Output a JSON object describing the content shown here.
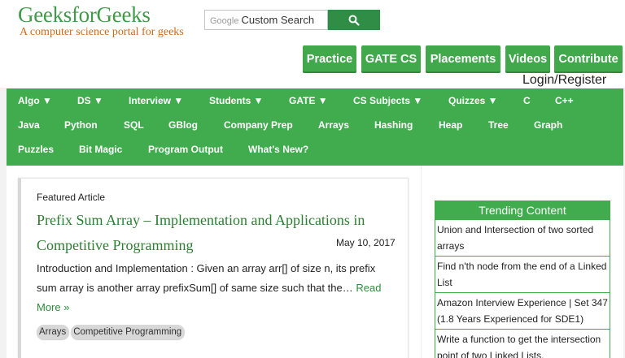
{
  "header": {
    "logo_title": "GeeksforGeeks",
    "logo_subtitle": "A computer science portal for geeks",
    "search_placeholder_brand": "Google",
    "search_placeholder": "Custom Search",
    "search_icon": "magnifier-icon",
    "top_nav": [
      "Practice",
      "GATE CS",
      "Placements",
      "Videos",
      "Contribute"
    ],
    "login_text": "Login/Register"
  },
  "menu": {
    "row1": [
      "Algo ▼",
      "DS ▼",
      "Interview ▼",
      "Students ▼",
      "GATE ▼",
      "CS Subjects ▼",
      "Quizzes ▼",
      "C",
      "C++"
    ],
    "row2": [
      "Java",
      "Python",
      "SQL",
      "GBlog",
      "Company Prep",
      "Arrays",
      "Hashing",
      "Heap",
      "Tree",
      "Graph"
    ],
    "row3": [
      "Puzzles",
      "Bit Magic",
      "Program Output",
      "What's New?"
    ]
  },
  "article": {
    "featured_label": "Featured Article",
    "title": "Prefix Sum Array – Implementation and Applications in Competitive Programming",
    "date": "May 10, 2017",
    "excerpt": "Introduction and Implementation : Given an array arr[] of size n, its prefix sum array is another array prefixSum[] of same size such that the…",
    "read_more": "Read More »",
    "tags": [
      "Arrays",
      "Competitive Programming"
    ]
  },
  "trending": {
    "title": "Trending Content",
    "items": [
      "Union and Intersection of two sorted arrays",
      "Find n'th node from the end of a Linked List",
      "Amazon Interview Experience | Set 347 (1.8 Years Experienced for SDE1)",
      "Write a function to get the intersection point of two Linked Lists."
    ]
  },
  "colors": {
    "brand_green": "#41ac4d",
    "title_green": "#2e7d32",
    "subtitle_orange": "#d26a1a"
  }
}
